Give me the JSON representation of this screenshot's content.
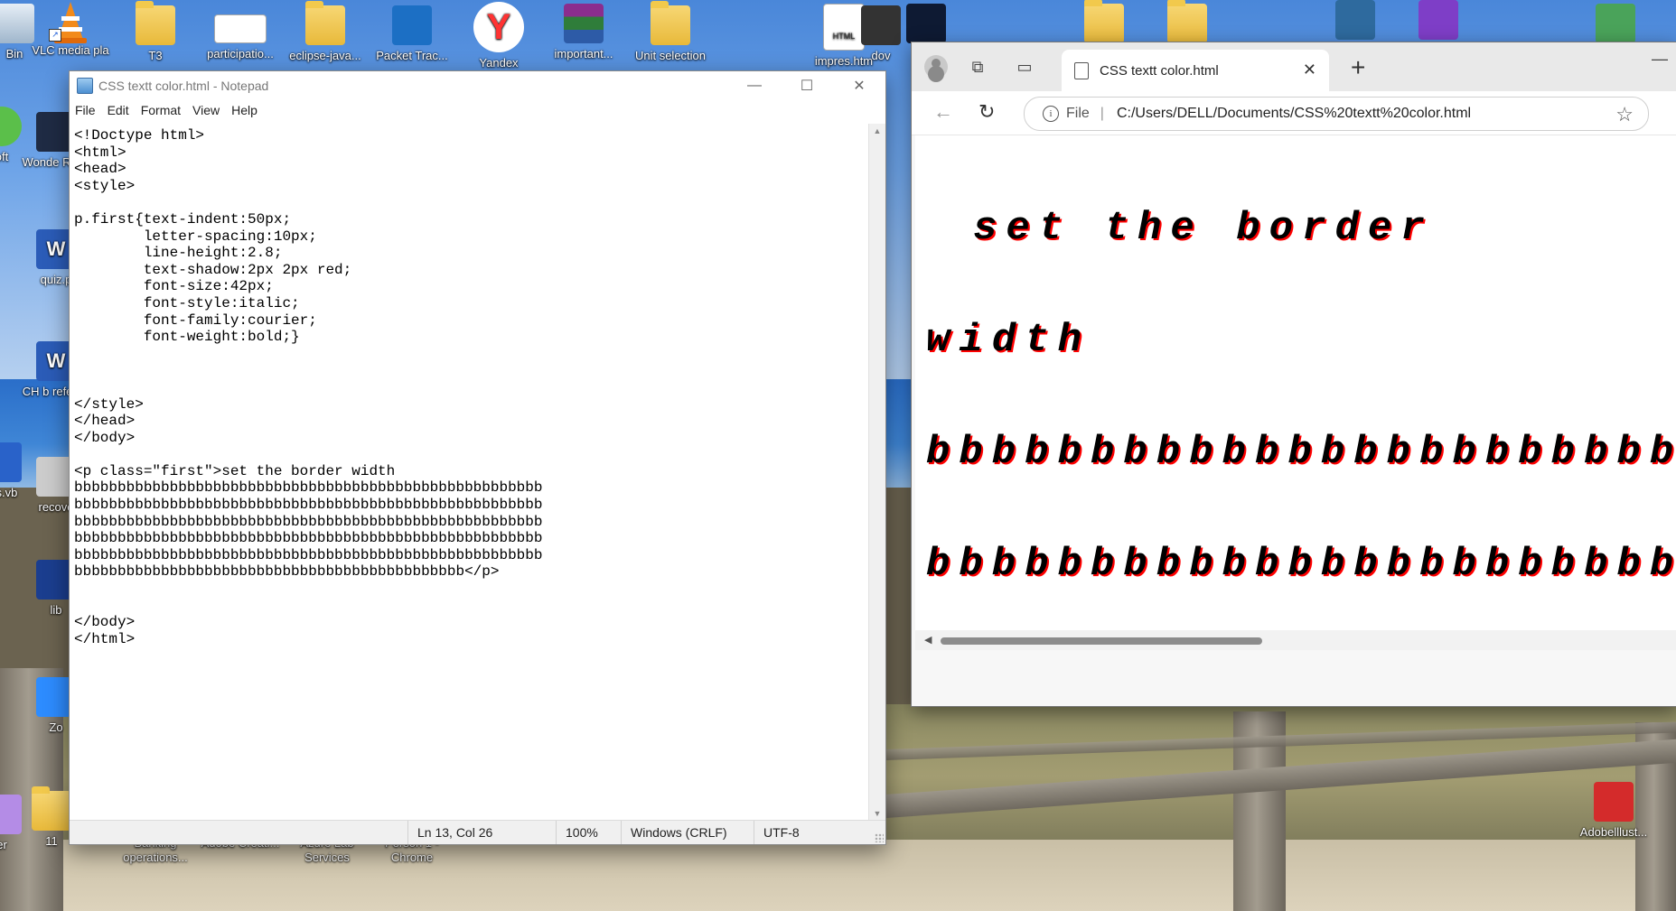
{
  "desktop": {
    "icons": [
      {
        "label": "Bin",
        "kind": "recycle"
      },
      {
        "label": "VLC media pla",
        "kind": "vlc"
      },
      {
        "label": "T3",
        "kind": "folder"
      },
      {
        "label": "participatio...",
        "kind": "doc"
      },
      {
        "label": "eclipse-java...",
        "kind": "folder"
      },
      {
        "label": "Packet Trac...",
        "kind": "packet"
      },
      {
        "label": "Yandex",
        "kind": "yandex"
      },
      {
        "label": "important...",
        "kind": "winrar"
      },
      {
        "label": "Unit selection",
        "kind": "folder"
      },
      {
        "label": "impres.htm",
        "kind": "html"
      },
      {
        "label": "dov",
        "kind": "doc"
      },
      {
        "label": "Wonde Reco",
        "kind": "app"
      },
      {
        "label": "quiz.p",
        "kind": "word"
      },
      {
        "label": "CH b referen",
        "kind": "word"
      },
      {
        "label": "recove",
        "kind": "app"
      },
      {
        "label": "lib",
        "kind": "app"
      },
      {
        "label": "Zo",
        "kind": "zoom"
      },
      {
        "label": "Banking operations...",
        "kind": "app"
      },
      {
        "label": "Adobe Creati...",
        "kind": "app"
      },
      {
        "label": "Azure Lab Services",
        "kind": "app"
      },
      {
        "label": "Person 1 - Chrome",
        "kind": "app"
      },
      {
        "label": "Adobelllust...",
        "kind": "pdf"
      },
      {
        "label": "oft",
        "kind": "app"
      },
      {
        "label": "g s.vb",
        "kind": "app"
      },
      {
        "label": "er",
        "kind": "app"
      },
      {
        "label": "11",
        "kind": "app"
      }
    ]
  },
  "notepad": {
    "title": "CSS textt color.html - Notepad",
    "menu": [
      "File",
      "Edit",
      "Format",
      "View",
      "Help"
    ],
    "content": "<!Doctype html>\n<html>\n<head>\n<style>\n\np.first{text-indent:50px;\n        letter-spacing:10px;\n        line-height:2.8;\n        text-shadow:2px 2px red;\n        font-size:42px;\n        font-style:italic;\n        font-family:courier;\n        font-weight:bold;}\n\n\n\n</style>\n</head>\n</body>\n\n<p class=\"first\">set the border width\nbbbbbbbbbbbbbbbbbbbbbbbbbbbbbbbbbbbbbbbbbbbbbbbbbbbbbb\nbbbbbbbbbbbbbbbbbbbbbbbbbbbbbbbbbbbbbbbbbbbbbbbbbbbbbb\nbbbbbbbbbbbbbbbbbbbbbbbbbbbbbbbbbbbbbbbbbbbbbbbbbbbbbb\nbbbbbbbbbbbbbbbbbbbbbbbbbbbbbbbbbbbbbbbbbbbbbbbbbbbbbb\nbbbbbbbbbbbbbbbbbbbbbbbbbbbbbbbbbbbbbbbbbbbbbbbbbbbbbb\nbbbbbbbbbbbbbbbbbbbbbbbbbbbbbbbbbbbbbbbbbbbbb</p>\n\n\n</body>\n</html>",
    "status": {
      "position": "Ln 13, Col 26",
      "zoom": "100%",
      "line_ending": "Windows (CRLF)",
      "encoding": "UTF-8"
    }
  },
  "browser": {
    "tab_title": "CSS textt color.html",
    "address_prefix": "File",
    "url": "C:/Users/DELL/Documents/CSS%20textt%20color.html",
    "rendered_lines": [
      "set the border",
      "width",
      "bbbbbbbbbbbbbbbbbbbbbbbbbbbbbb",
      "bbbbbbbbbbbbbbbbbbbbbbbbbbbbbb"
    ]
  }
}
